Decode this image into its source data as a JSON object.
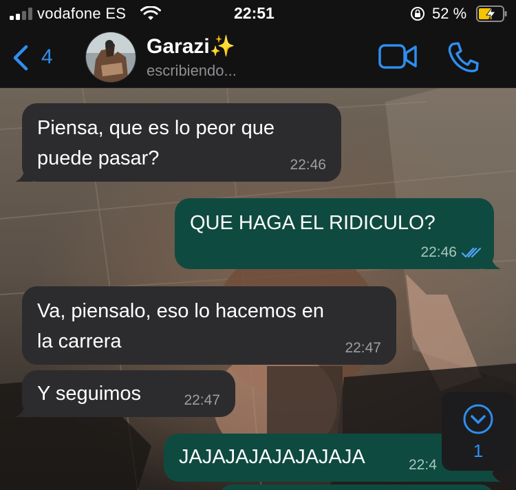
{
  "status_bar": {
    "carrier": "vodafone ES",
    "time": "22:51",
    "battery_percent": "52 %",
    "signal_bars_filled": 2,
    "signal_bars_total": 4
  },
  "header": {
    "back_count": "4",
    "contact_name": "Garazi✨",
    "contact_status": "escribiendo...",
    "accent_color": "#2f8ef0"
  },
  "messages": [
    {
      "direction": "incoming",
      "text": "Piensa, que es lo peor que\npuede pasar?",
      "time": "22:46"
    },
    {
      "direction": "outgoing",
      "text": "QUE HAGA EL RIDICULO?",
      "time": "22:46",
      "read": true
    },
    {
      "direction": "incoming",
      "text": "Va, piensalo, eso lo hacemos en\nla carrera",
      "time": "22:47"
    },
    {
      "direction": "incoming",
      "text": "Y seguimos",
      "time": "22:47"
    },
    {
      "direction": "outgoing",
      "text": "JAJAJAJAJAJAJAJA",
      "time": "22:4"
    }
  ],
  "scroll_down": {
    "unread_count": "1"
  },
  "colors": {
    "incoming_bubble": "#2c2c2e",
    "outgoing_bubble": "#0f4a40",
    "bar_background": "#121212"
  }
}
